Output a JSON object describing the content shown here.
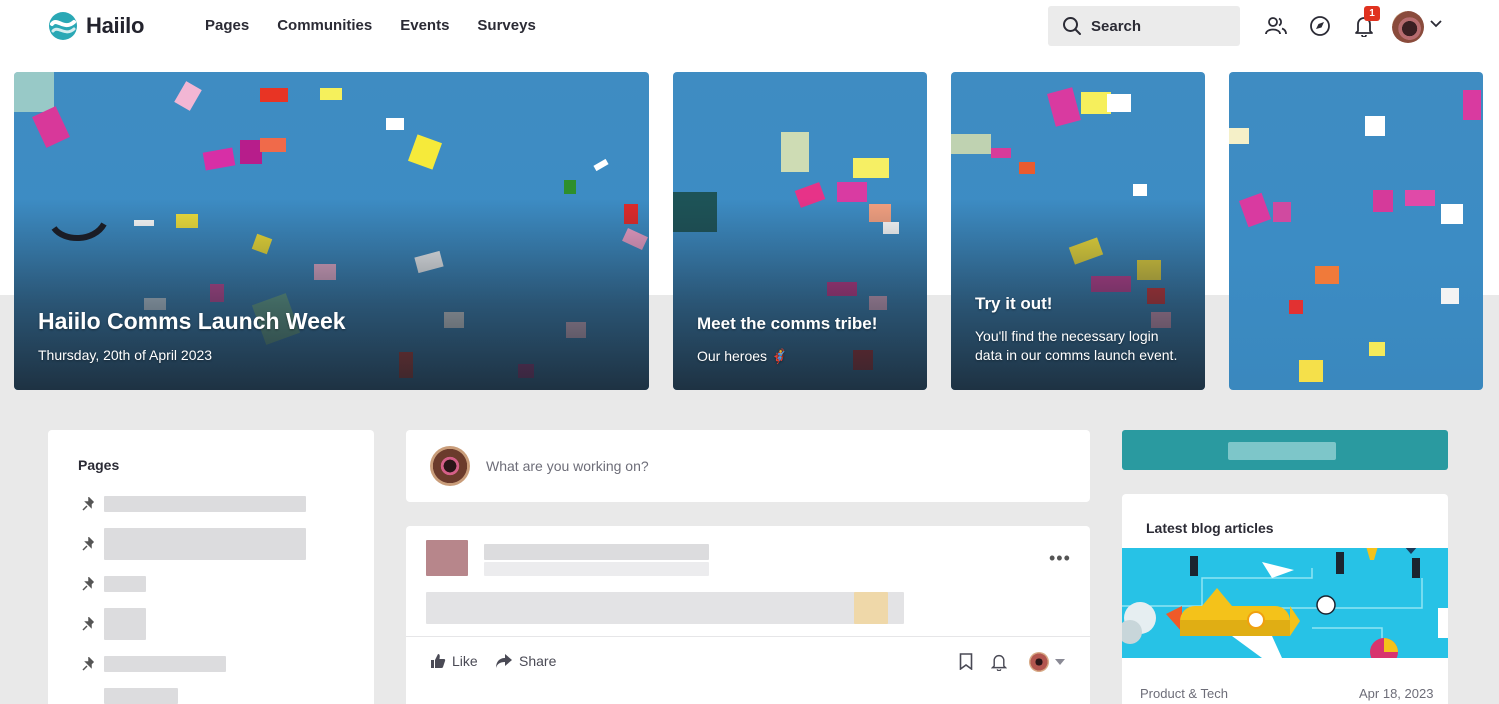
{
  "app": {
    "name": "Haiilo"
  },
  "nav": {
    "items": [
      "Pages",
      "Communities",
      "Events",
      "Surveys"
    ]
  },
  "search": {
    "label": "Search"
  },
  "notifications": {
    "count": "1"
  },
  "hero": {
    "main": {
      "title": "Haiilo Comms Launch Week",
      "subtitle": "Thursday, 20th of April 2023"
    },
    "tile2": {
      "title": "Meet the comms tribe!",
      "subtitle": "Our heroes 🦸"
    },
    "tile3": {
      "title": "Try it out!",
      "subtitle_line1": "You'll find the necessary login",
      "subtitle_line2": "data in our comms launch event."
    }
  },
  "pages_widget": {
    "title": "Pages"
  },
  "composer": {
    "placeholder": "What are you working on?"
  },
  "post": {
    "like_label": "Like",
    "share_label": "Share"
  },
  "blog": {
    "title": "Latest blog articles",
    "category": "Product & Tech",
    "date": "Apr 18, 2023"
  },
  "colors": {
    "brand_teal": "#2a9aa0",
    "hero_blue": "#3c8cc4",
    "badge_red": "#e0321f"
  }
}
